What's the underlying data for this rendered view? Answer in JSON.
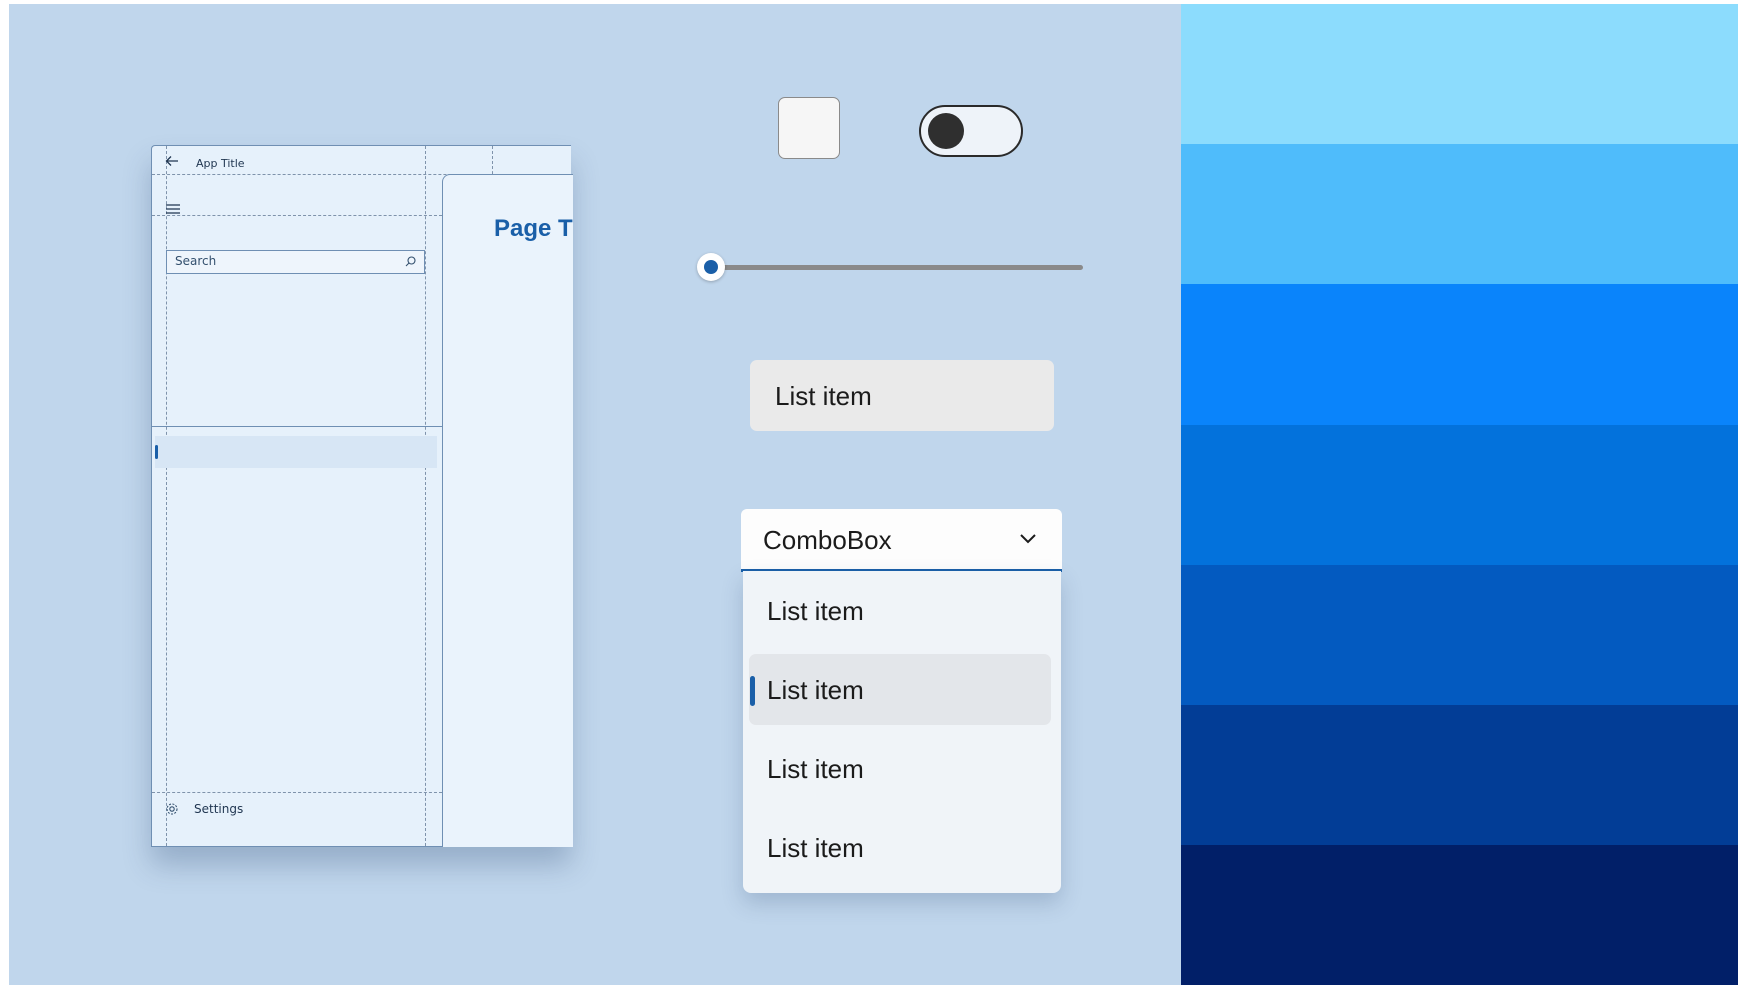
{
  "app_window": {
    "title": "App Title",
    "search_placeholder": "Search",
    "settings_label": "Settings",
    "page_title": "Page T"
  },
  "controls": {
    "checkbox_checked": false,
    "toggle_on": false,
    "slider_value": 0,
    "standalone_item_label": "List item"
  },
  "combobox": {
    "value": "ComboBox",
    "options": [
      "List item",
      "List item",
      "List item",
      "List item"
    ],
    "selected_index": 1
  },
  "swatches": [
    "#8cdcfd",
    "#4fbcfb",
    "#0a84fb",
    "#0372dc",
    "#035ac0",
    "#023d96",
    "#011f68"
  ],
  "colors": {
    "background": "#c0d6ec",
    "accent": "#1a5fa8"
  }
}
